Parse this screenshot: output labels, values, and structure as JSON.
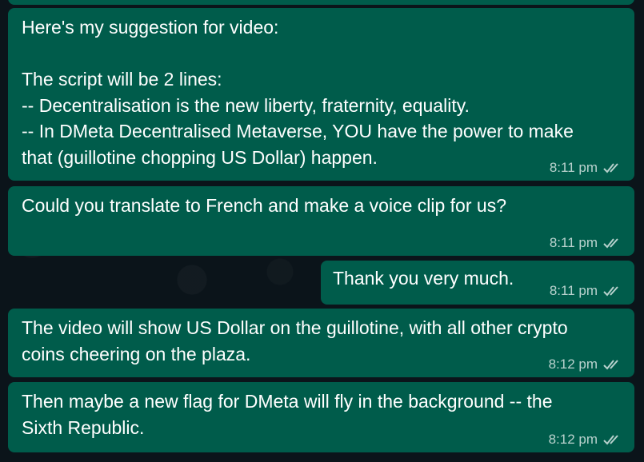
{
  "messages": [
    {
      "text": "Here's my suggestion for video:\n\nThe script will be 2 lines:\n-- Decentralisation is the new liberty, fraternity, equality.\n-- In DMeta Decentralised Metaverse, YOU have the power to make\nthat (guillotine chopping US Dollar) happen.",
      "time": "8:11 pm"
    },
    {
      "text": "Could you translate to French and make a voice clip for us?",
      "time": "8:11 pm"
    },
    {
      "text": "Thank you very much.",
      "time": "8:11 pm"
    },
    {
      "text": "The video will show US Dollar on the guillotine, with all other crypto\ncoins cheering on the plaza.",
      "time": "8:12 pm"
    },
    {
      "text": "Then maybe a new flag for DMeta will fly in the background -- the\nSixth Republic.",
      "time": "8:12 pm"
    }
  ],
  "colors": {
    "chat_background": "#0b141a",
    "outgoing_bubble": "#005c4b",
    "meta_text": "#b3cdc8"
  },
  "icons": {
    "status": "double-check-icon"
  }
}
